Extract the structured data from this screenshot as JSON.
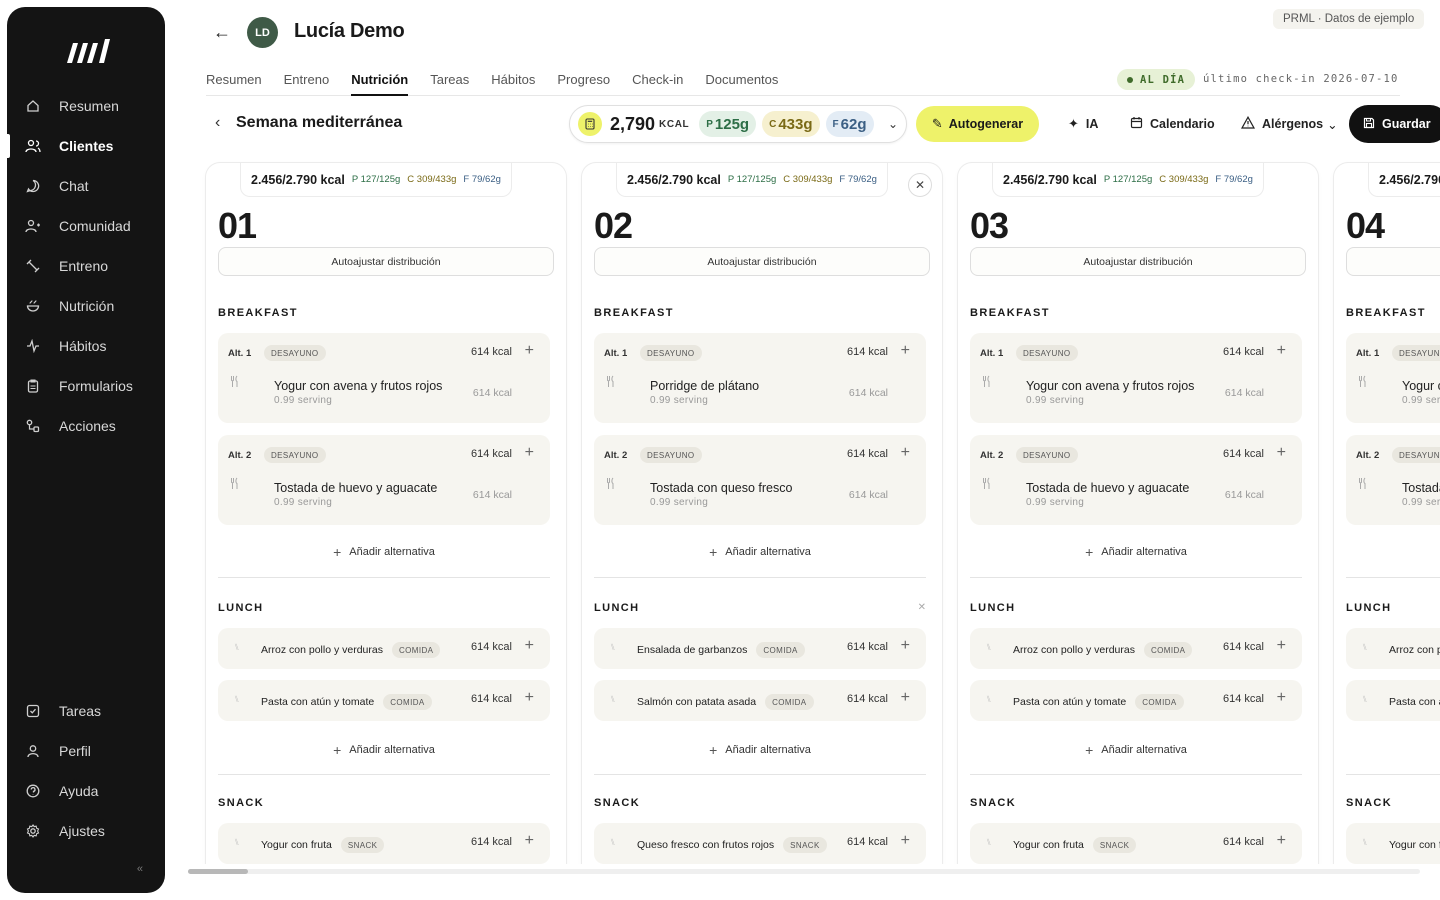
{
  "sidebar": {
    "nav_top": [
      {
        "label": "Resumen",
        "icon": "home-icon",
        "active": false
      },
      {
        "label": "Clientes",
        "icon": "users-icon",
        "active": true
      },
      {
        "label": "Chat",
        "icon": "chat-icon",
        "active": false
      },
      {
        "label": "Comunidad",
        "icon": "community-icon",
        "active": false
      },
      {
        "label": "Entreno",
        "icon": "dumbbell-icon",
        "active": false
      },
      {
        "label": "Nutrición",
        "icon": "bowl-icon",
        "active": false
      },
      {
        "label": "Hábitos",
        "icon": "activity-icon",
        "active": false
      },
      {
        "label": "Formularios",
        "icon": "clipboard-icon",
        "active": false
      },
      {
        "label": "Acciones",
        "icon": "workflow-icon",
        "active": false
      }
    ],
    "nav_bottom": [
      {
        "label": "Tareas",
        "icon": "checkbox-icon"
      },
      {
        "label": "Perfil",
        "icon": "user-icon"
      },
      {
        "label": "Ayuda",
        "icon": "help-icon"
      },
      {
        "label": "Ajustes",
        "icon": "settings-icon"
      }
    ],
    "collapse_glyph": "«"
  },
  "header": {
    "client_initials": "LD",
    "client_name": "Lucía Demo",
    "sample_badge": "PRML · Datos de ejemplo",
    "status": "AL DÍA",
    "last_checkin": "último check-in 2026-07-10"
  },
  "tabs": [
    "Resumen",
    "Entreno",
    "Nutrición",
    "Tareas",
    "Hábitos",
    "Progreso",
    "Check-in",
    "Documentos"
  ],
  "active_tab": "Nutrición",
  "toolbar": {
    "plan_title": "Semana mediterránea",
    "kcal": "2,790",
    "kcal_unit": "KCAL",
    "protein": "125g",
    "carbs": "433g",
    "fat": "62g",
    "p_letter": "P",
    "c_letter": "C",
    "f_letter": "F",
    "autogen_label": "Autogenerar",
    "ai_label": "IA",
    "calendar_label": "Calendario",
    "allergens_label": "Alérgenos",
    "save_label": "Guardar"
  },
  "day_common": {
    "summary_kcal": "2.456/2.790 kcal",
    "summary_p": "P 127/125g",
    "summary_c": "C 309/433g",
    "summary_f": "F 79/62g",
    "autoadjust_label": "Autoajustar distribución",
    "add_alt_label": "Añadir alternativa",
    "serving": "0.99 serving",
    "kcal": "614 kcal"
  },
  "meal_titles": {
    "breakfast": "BREAKFAST",
    "lunch": "LUNCH",
    "snack": "SNACK"
  },
  "badges": {
    "breakfast": "DESAYUNO",
    "lunch": "COMIDA",
    "snack": "SNACK"
  },
  "alt_labels": [
    "Alt. 1",
    "Alt. 2"
  ],
  "days": [
    {
      "num": "01",
      "breakfast": [
        "Yogur con avena y frutos rojos",
        "Tostada de huevo y aguacate"
      ],
      "lunch": [
        "Arroz con pollo y verduras",
        "Pasta con atún y tomate"
      ],
      "snack": [
        "Yogur con fruta"
      ]
    },
    {
      "num": "02",
      "breakfast": [
        "Porridge de plátano",
        "Tostada con queso fresco"
      ],
      "lunch": [
        "Ensalada de garbanzos",
        "Salmón con patata asada"
      ],
      "snack": [
        "Queso fresco con frutos rojos"
      ]
    },
    {
      "num": "03",
      "breakfast": [
        "Yogur con avena y frutos rojos",
        "Tostada de huevo y aguacate"
      ],
      "lunch": [
        "Arroz con pollo y verduras",
        "Pasta con atún y tomate"
      ],
      "snack": [
        "Yogur con fruta"
      ]
    },
    {
      "num": "04",
      "breakfast": [
        "Yogur con avena y frutos rojos",
        "Tostada de huevo y aguacate"
      ],
      "lunch": [
        "Arroz con pollo y verduras",
        "Pasta con atún y tomate"
      ],
      "snack": [
        "Yogur con fruta"
      ]
    }
  ],
  "colors": {
    "accent": "#eef26a",
    "sidebar_bg": "#141414",
    "status_green": "#3f6b2a"
  }
}
